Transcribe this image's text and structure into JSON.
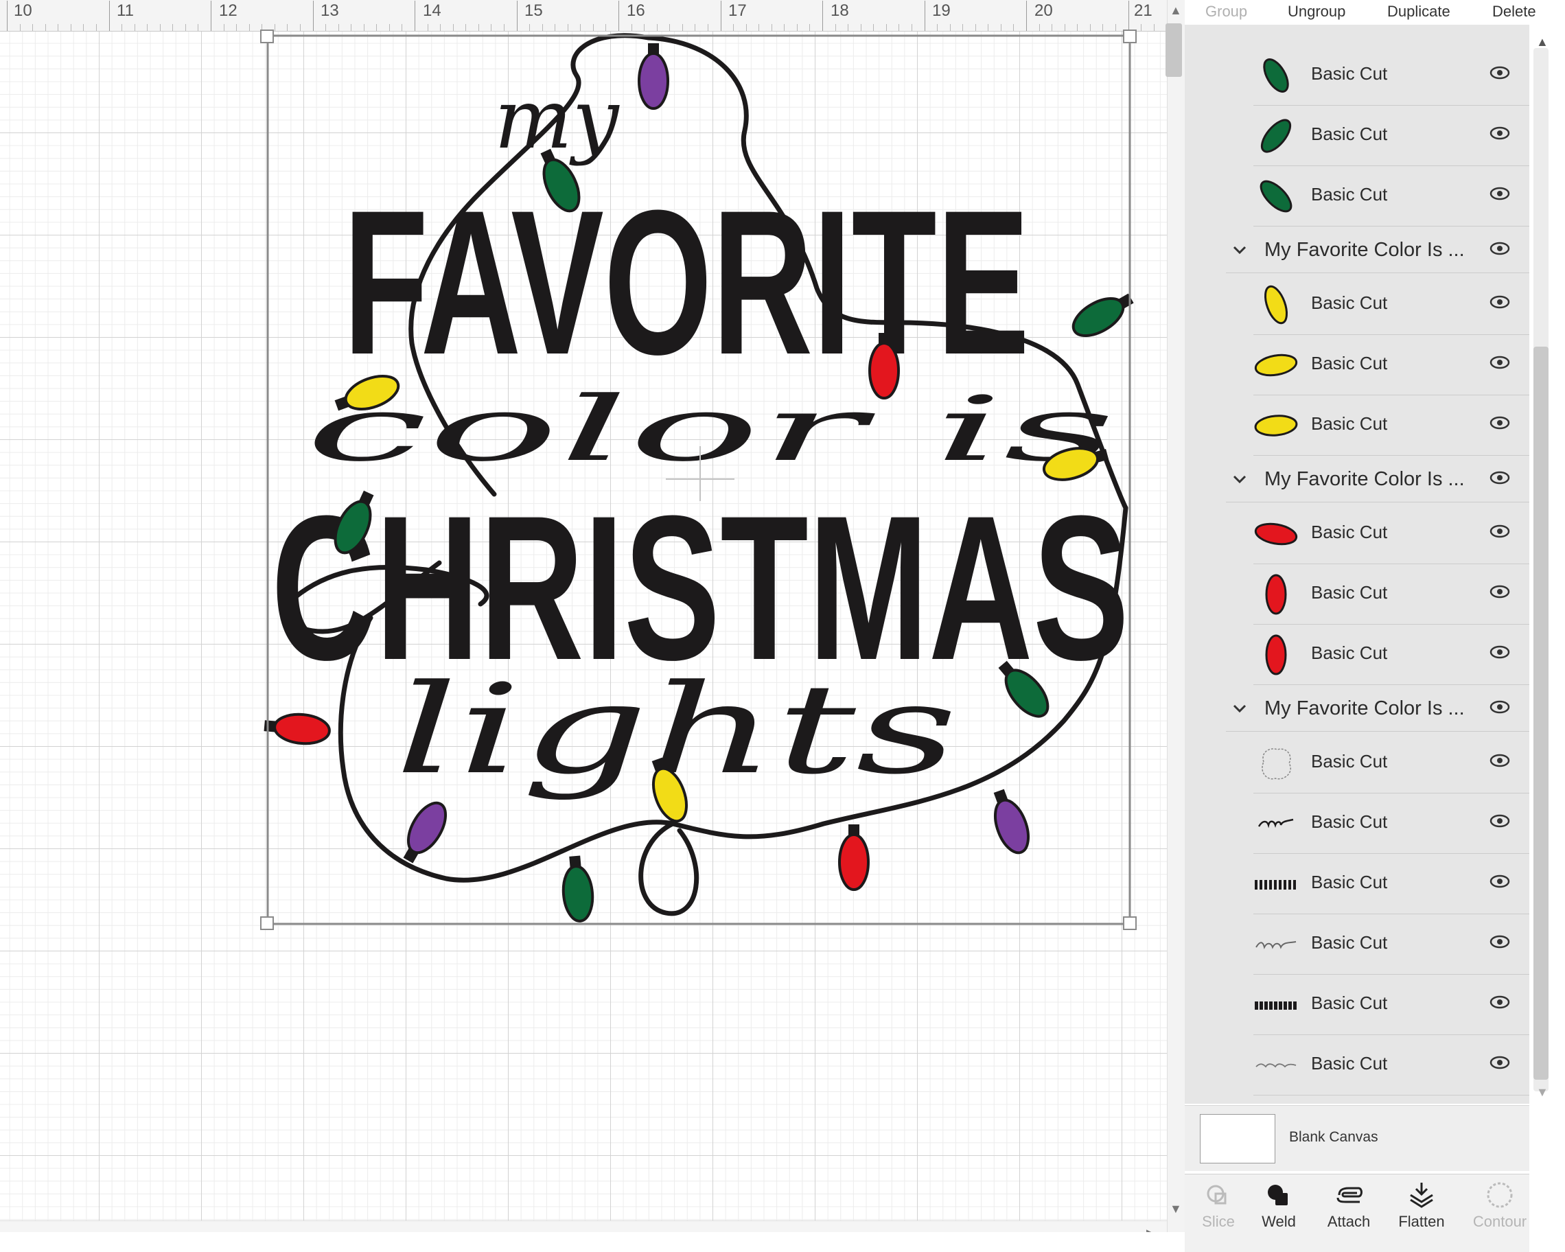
{
  "ruler": {
    "labels": [
      "10",
      "11",
      "12",
      "13",
      "14",
      "15",
      "16",
      "17",
      "18",
      "19",
      "20",
      "21"
    ]
  },
  "design": {
    "text_script_1": "my",
    "text_block_1": "FAVORITE",
    "text_script_2": "color is",
    "text_block_2": "CHRISTMAS",
    "text_script_3": "lights",
    "bulb_colors": {
      "purple": "#7b3fa0",
      "green": "#0d6b3a",
      "yellow": "#f2dc17",
      "red": "#e3161e"
    }
  },
  "toolbar": {
    "group": "Group",
    "ungroup": "Ungroup",
    "duplicate": "Duplicate",
    "delete": "Delete"
  },
  "layers": {
    "items": [
      {
        "kind": "child",
        "label": "Basic Cut",
        "thumb": "green"
      },
      {
        "kind": "child",
        "label": "Basic Cut",
        "thumb": "green"
      },
      {
        "kind": "child",
        "label": "Basic Cut",
        "thumb": "green"
      },
      {
        "kind": "group",
        "label": "My Favorite Color Is ..."
      },
      {
        "kind": "child",
        "label": "Basic Cut",
        "thumb": "yellow"
      },
      {
        "kind": "child",
        "label": "Basic Cut",
        "thumb": "yellow"
      },
      {
        "kind": "child",
        "label": "Basic Cut",
        "thumb": "yellow"
      },
      {
        "kind": "group",
        "label": "My Favorite Color Is ..."
      },
      {
        "kind": "child",
        "label": "Basic Cut",
        "thumb": "red"
      },
      {
        "kind": "child",
        "label": "Basic Cut",
        "thumb": "red"
      },
      {
        "kind": "child",
        "label": "Basic Cut",
        "thumb": "red"
      },
      {
        "kind": "group",
        "label": "My Favorite Color Is ..."
      },
      {
        "kind": "child",
        "label": "Basic Cut",
        "thumb": "outline"
      },
      {
        "kind": "child",
        "label": "Basic Cut",
        "thumb": "my"
      },
      {
        "kind": "child",
        "label": "Basic Cut",
        "thumb": "FAVORITE"
      },
      {
        "kind": "child",
        "label": "Basic Cut",
        "thumb": "lights"
      },
      {
        "kind": "child",
        "label": "Basic Cut",
        "thumb": "CHRISTMAS"
      },
      {
        "kind": "child",
        "label": "Basic Cut",
        "thumb": "color is"
      }
    ]
  },
  "blank_canvas": {
    "label": "Blank Canvas"
  },
  "bottom_tools": {
    "slice": "Slice",
    "weld": "Weld",
    "attach": "Attach",
    "flatten": "Flatten",
    "contour": "Contour"
  }
}
